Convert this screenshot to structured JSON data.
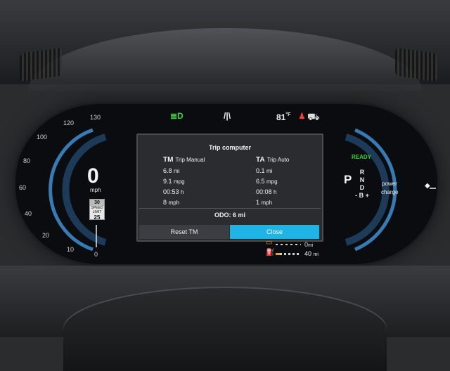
{
  "colors": {
    "accent_blue": "#1fb3e6",
    "ready_green": "#36d335",
    "warning_red": "#ff3a3a",
    "fuel_orange": "#f4a020"
  },
  "speedometer": {
    "ticks": [
      "130",
      "120",
      "100",
      "80",
      "60",
      "40",
      "20",
      "10",
      "0"
    ],
    "speed": "0",
    "unit": "mph",
    "limit_sign": {
      "top": "30",
      "middle": "SPEED LIMIT",
      "value": "25"
    }
  },
  "status_bar": {
    "lamp_icon": "headlight-icon",
    "lane_icon": "lane-assist-icon",
    "temperature": "81",
    "temperature_unit": "°F",
    "seatbelt_icon": "seatbelt-warning-icon",
    "car_icon": "door-open-car-icon"
  },
  "popup": {
    "title": "Trip computer",
    "tm": {
      "abbr": "TM",
      "label": "Trip Manual",
      "rows": [
        {
          "value": "6.8",
          "unit": "mi"
        },
        {
          "value": "9.1",
          "unit": "mpg"
        },
        {
          "value": "00:53",
          "unit": "h"
        },
        {
          "value": "8",
          "unit": "mph"
        }
      ]
    },
    "ta": {
      "abbr": "TA",
      "label": "Trip Auto",
      "rows": [
        {
          "value": "0.1",
          "unit": "mi"
        },
        {
          "value": "6.5",
          "unit": "mpg"
        },
        {
          "value": "00:08",
          "unit": "h"
        },
        {
          "value": "1",
          "unit": "mph"
        }
      ]
    },
    "odo_label": "ODO:",
    "odo_value": "6",
    "odo_unit": "mi",
    "reset_label": "Reset TM",
    "close_label": "Close"
  },
  "drive": {
    "ready": "READY",
    "current_gear": "P",
    "gears": [
      "R",
      "N",
      "D",
      "- B +"
    ],
    "power_label": "power",
    "charge_label": "charge"
  },
  "range": {
    "row1_value": "0",
    "row1_unit": "mi",
    "row2_value": "40",
    "row2_unit": "mi"
  }
}
